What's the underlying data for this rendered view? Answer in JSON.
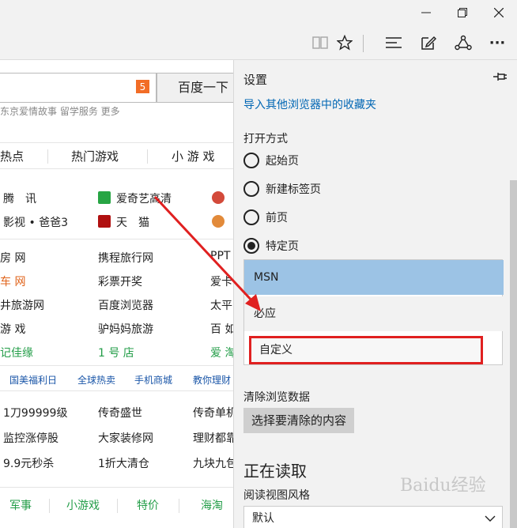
{
  "window": {
    "buttons": [
      "minimize",
      "restore",
      "close"
    ]
  },
  "toolbar": {
    "icons": [
      "reading-view-icon",
      "favorite-star-icon",
      "hub-icon",
      "web-note-icon",
      "share-icon",
      "more-icon"
    ],
    "more_label": "···"
  },
  "page": {
    "badge": "5",
    "search_button": "百度一下",
    "strip_text": "东京爱情故事    留学服务      更多",
    "tabs": [
      "热点",
      "热门游戏",
      "小 游 戏"
    ],
    "rows1": [
      [
        "腾　讯",
        "爱奇艺高清"
      ],
      [
        "影视 • 爸爸3",
        "天　猫"
      ]
    ],
    "grid": [
      [
        "房 网",
        "携程旅行网",
        "PPT"
      ],
      [
        "车 网",
        "彩票开奖",
        "爱卡"
      ],
      [
        "井旅游网",
        "百度浏览器",
        "太平"
      ],
      [
        "游 戏",
        "驴妈妈旅游",
        "百 如"
      ],
      [
        "记佳缘",
        "1 号 店",
        "爱 淘"
      ]
    ],
    "promo": [
      "国美福利日",
      "全球热卖",
      "手机商城",
      "教你理财"
    ],
    "grid2": [
      [
        "1刀99999级",
        "传奇盛世",
        "传奇单机"
      ],
      [
        "监控涨停股",
        "大家装修网",
        "理财都靠"
      ],
      [
        "9.9元秒杀",
        "1折大清仓",
        "九块九包"
      ]
    ],
    "bottom_links": [
      "军事",
      "小游戏",
      "特价",
      "海淘"
    ]
  },
  "settings": {
    "title": "设置",
    "import_link": "导入其他浏览器中的收藏夹",
    "open_with_label": "打开方式",
    "radios": [
      {
        "label": "起始页",
        "checked": false
      },
      {
        "label": "新建标签页",
        "checked": false
      },
      {
        "label": "前页",
        "checked": false
      },
      {
        "label": "特定页",
        "checked": true
      }
    ],
    "options": [
      "MSN",
      "必应",
      "自定义"
    ],
    "selected_option": "MSN",
    "clear_label": "清除浏览数据",
    "clear_button": "选择要清除的内容",
    "reading_title": "正在读取",
    "reading_style_label": "阅读视图风格",
    "reading_style_value": "默认"
  },
  "watermark": "Baidu经验",
  "colors": {
    "accent_blue": "#0066b4",
    "highlight": "#9cc3e5",
    "annotation_red": "#e02020",
    "badge_orange": "#f26d26"
  }
}
